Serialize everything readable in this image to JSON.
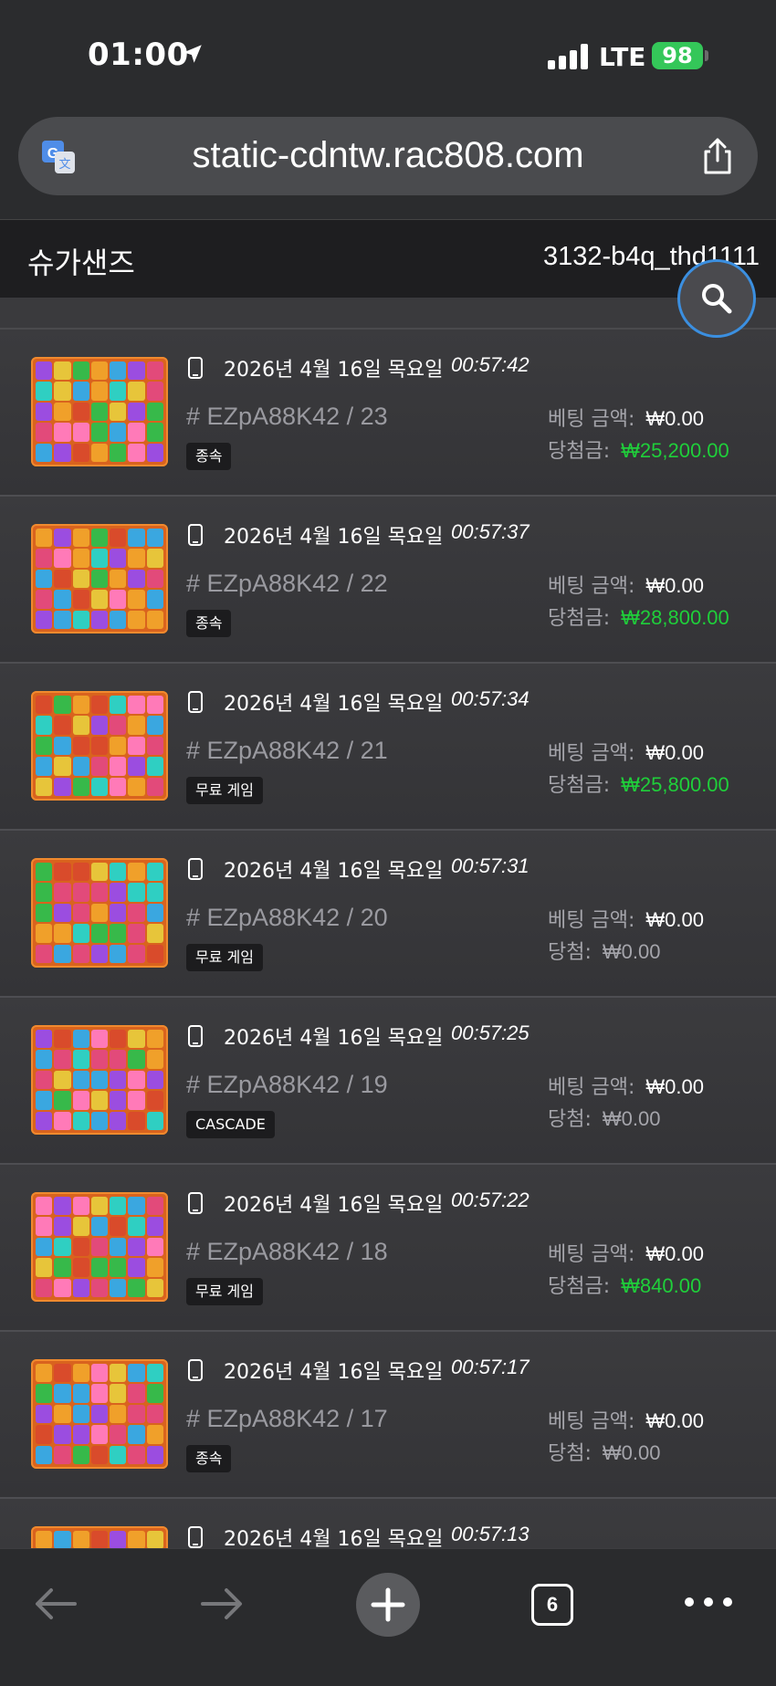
{
  "status_bar": {
    "time": "01:00",
    "network": "LTE",
    "battery": "98"
  },
  "browser": {
    "url": "static-cdntw.rac808.com",
    "tab_count": "6"
  },
  "header": {
    "game_title": "슈가샌즈",
    "user_id": "3132-b4q_thd1111"
  },
  "colors": {
    "win_green": "#1fcf3a",
    "accent_blue": "#3b8fe0"
  },
  "rows": [
    {
      "date": "2026년 4월 16일 목요일",
      "time": "00:57:42",
      "round": "# EZpA88K42 / 23",
      "tag": "종속",
      "bet_label": "베팅 금액:",
      "bet_amount": "₩0.00",
      "win_label": "당첨금:",
      "win_amount": "₩25,200.00",
      "win_state": "green"
    },
    {
      "date": "2026년 4월 16일 목요일",
      "time": "00:57:37",
      "round": "# EZpA88K42 / 22",
      "tag": "종속",
      "bet_label": "베팅 금액:",
      "bet_amount": "₩0.00",
      "win_label": "당첨금:",
      "win_amount": "₩28,800.00",
      "win_state": "green"
    },
    {
      "date": "2026년 4월 16일 목요일",
      "time": "00:57:34",
      "round": "# EZpA88K42 / 21",
      "tag": "무료 게임",
      "bet_label": "베팅 금액:",
      "bet_amount": "₩0.00",
      "win_label": "당첨금:",
      "win_amount": "₩25,800.00",
      "win_state": "green"
    },
    {
      "date": "2026년 4월 16일 목요일",
      "time": "00:57:31",
      "round": "# EZpA88K42 / 20",
      "tag": "무료 게임",
      "bet_label": "베팅 금액:",
      "bet_amount": "₩0.00",
      "win_label": "당첨:",
      "win_amount": "₩0.00",
      "win_state": "grey"
    },
    {
      "date": "2026년 4월 16일 목요일",
      "time": "00:57:25",
      "round": "# EZpA88K42 / 19",
      "tag": "CASCADE",
      "bet_label": "베팅 금액:",
      "bet_amount": "₩0.00",
      "win_label": "당첨:",
      "win_amount": "₩0.00",
      "win_state": "grey"
    },
    {
      "date": "2026년 4월 16일 목요일",
      "time": "00:57:22",
      "round": "# EZpA88K42 / 18",
      "tag": "무료 게임",
      "bet_label": "베팅 금액:",
      "bet_amount": "₩0.00",
      "win_label": "당첨금:",
      "win_amount": "₩840.00",
      "win_state": "green"
    },
    {
      "date": "2026년 4월 16일 목요일",
      "time": "00:57:17",
      "round": "# EZpA88K42 / 17",
      "tag": "종속",
      "bet_label": "베팅 금액:",
      "bet_amount": "₩0.00",
      "win_label": "당첨:",
      "win_amount": "₩0.00",
      "win_state": "grey"
    },
    {
      "date": "2026년 4월 16일 목요일",
      "time": "00:57:13",
      "round": "",
      "tag": "",
      "bet_label": "",
      "bet_amount": "",
      "win_label": "",
      "win_amount": "",
      "win_state": "grey"
    }
  ]
}
